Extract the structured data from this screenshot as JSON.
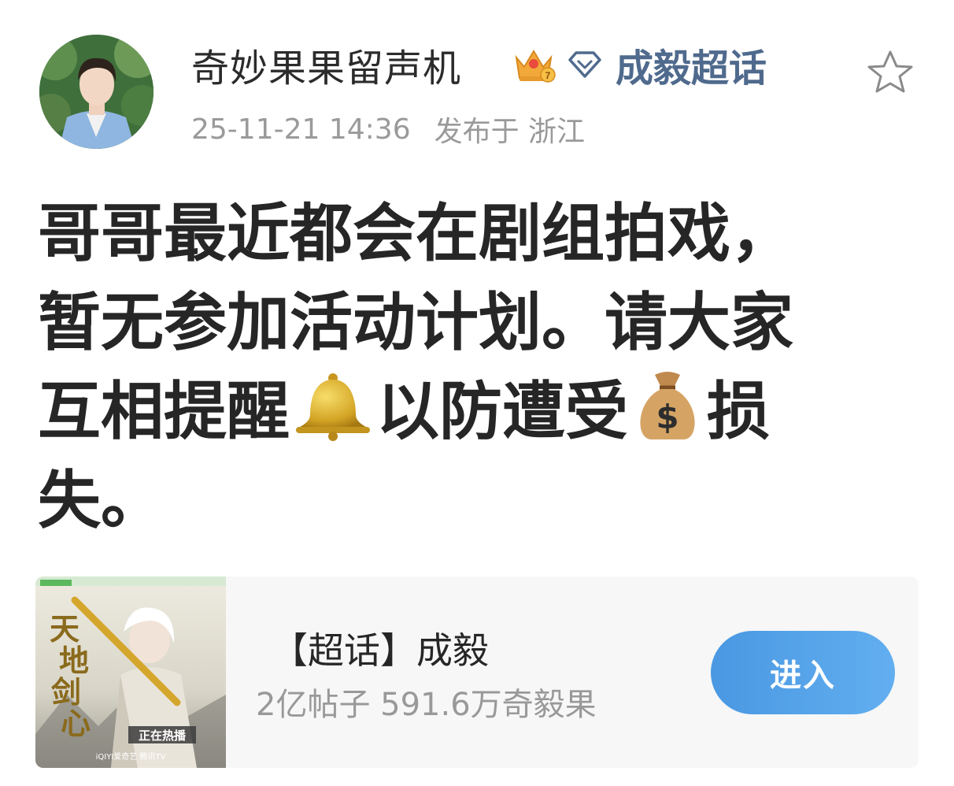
{
  "post": {
    "author": "奇妙果果留声机",
    "supertopic": "成毅超话",
    "time": "25-11-21 14:36",
    "location": "发布于 浙江",
    "text_lines": [
      "哥哥最近都会在剧组拍戏，",
      "暂无参加活动计划。请大家",
      "互相提醒",
      "以防遭受",
      "损",
      "失。"
    ],
    "icons": {
      "crown": "crown-icon",
      "diamond": "diamond-icon",
      "star": "star-icon",
      "bell": "bell-emoji",
      "money_bag": "money-bag-emoji"
    }
  },
  "card": {
    "title": "【超话】成毅",
    "subtitle": "2亿帖子 591.6万奇毅果",
    "button_label": "进入",
    "poster": {
      "title_chars": [
        "天",
        "地",
        "剑",
        "心"
      ],
      "badge": "正在热播",
      "footer": "iQIYI爱奇艺  腾讯TV"
    }
  },
  "colors": {
    "link": "#4f6a8d",
    "meta": "#9a9a9a",
    "button": "#4a98e2",
    "card_bg": "#f7f7f7"
  }
}
